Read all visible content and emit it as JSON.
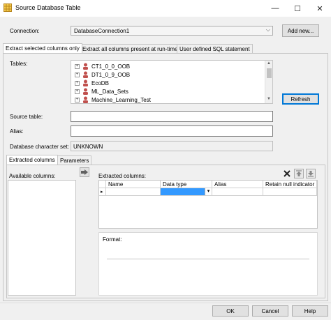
{
  "window": {
    "title": "Source Database Table",
    "minimize": "—",
    "maximize": "☐",
    "close": "✕"
  },
  "connection": {
    "label": "Connection:",
    "value": "DatabaseConnection1",
    "add_button": "Add new..."
  },
  "main_tabs": [
    {
      "label": "Extract selected columns only",
      "active": true
    },
    {
      "label": "Extract all columns present at run-time",
      "active": false
    },
    {
      "label": "User defined SQL statement",
      "active": false
    }
  ],
  "tables": {
    "label": "Tables:",
    "items": [
      {
        "expander": "+",
        "label": "CT1_0_0_OOB"
      },
      {
        "expander": "+",
        "label": "DT1_0_9_OOB"
      },
      {
        "expander": "+",
        "label": "EcoDB"
      },
      {
        "expander": "+",
        "label": "ML_Data_Sets"
      },
      {
        "expander": "+",
        "label": "Machine_Learning_Test"
      }
    ],
    "refresh_button": "Refresh"
  },
  "source_table": {
    "label": "Source table:",
    "value": ""
  },
  "alias": {
    "label": "Alias:",
    "value": ""
  },
  "charset": {
    "label": "Database character set:",
    "value": "UNKNOWN"
  },
  "sub_tabs": [
    {
      "label": "Extracted columns",
      "active": true
    },
    {
      "label": "Parameters",
      "active": false
    }
  ],
  "available_columns": {
    "label": "Available columns:"
  },
  "extracted_columns": {
    "label": "Extracted columns:",
    "headers": [
      "Name",
      "Data type",
      "Alias",
      "Retain null indicator"
    ],
    "row_marker": "▸"
  },
  "format": {
    "label": "Format:"
  },
  "footer": {
    "ok": "OK",
    "cancel": "Cancel",
    "help": "Help"
  },
  "colors": {
    "selection": "#3399ff",
    "focus_border": "#0078d7",
    "db_icon": "#c0504d"
  },
  "icons": {
    "app": "table-icon",
    "move": "arrow-right-icon",
    "delete": "delete-x-icon",
    "move_up": "move-up-icon",
    "move_down": "move-down-icon"
  }
}
